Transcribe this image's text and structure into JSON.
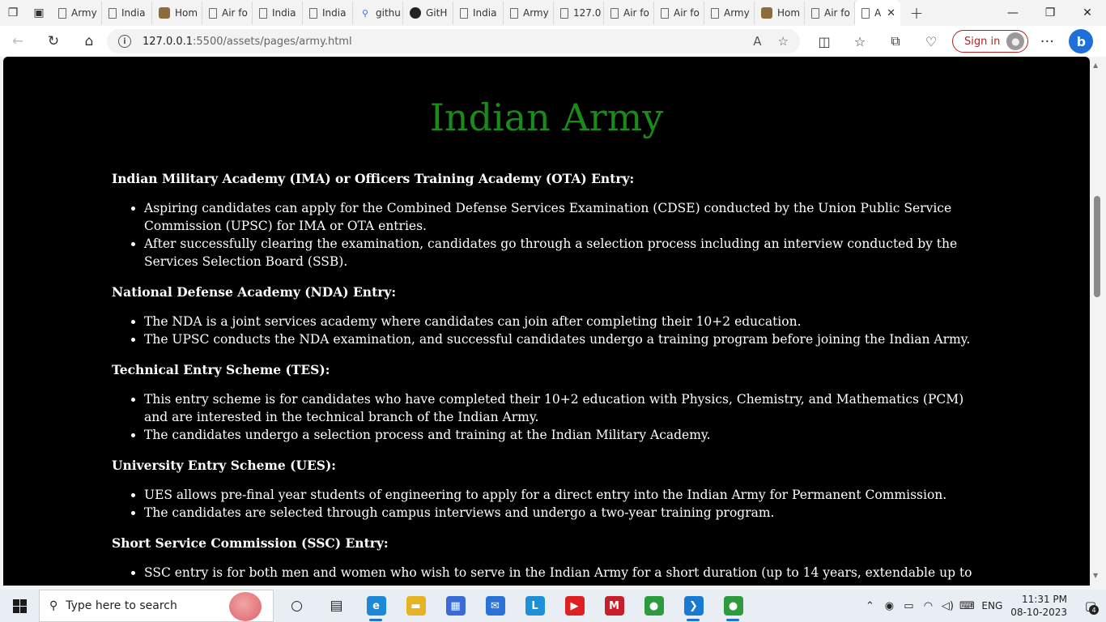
{
  "browser": {
    "tabs": [
      {
        "label": "Army",
        "icon": "page-icon"
      },
      {
        "label": "India",
        "icon": "page-icon"
      },
      {
        "label": "Hom",
        "icon": "emblem-icon"
      },
      {
        "label": "Air fo",
        "icon": "page-icon"
      },
      {
        "label": "India",
        "icon": "page-icon"
      },
      {
        "label": "India",
        "icon": "page-icon"
      },
      {
        "label": "githu",
        "icon": "search-icon"
      },
      {
        "label": "GitH",
        "icon": "github-icon"
      },
      {
        "label": "India",
        "icon": "page-icon"
      },
      {
        "label": "Army",
        "icon": "page-icon"
      },
      {
        "label": "127.0",
        "icon": "page-icon"
      },
      {
        "label": "Air fo",
        "icon": "page-icon"
      },
      {
        "label": "Air fo",
        "icon": "page-icon"
      },
      {
        "label": "Army",
        "icon": "page-icon"
      },
      {
        "label": "Hom",
        "icon": "emblem-icon"
      },
      {
        "label": "Air fo",
        "icon": "page-icon"
      }
    ],
    "active_tab": {
      "label": "A",
      "close": "✕"
    },
    "new_tab": "+",
    "url_host": "127.0.0.1",
    "url_rest": ":5500/assets/pages/army.html",
    "signin_label": "Sign in",
    "more": "···"
  },
  "page": {
    "title": "Indian Army",
    "title_color": "#1a8a1a",
    "sections": [
      {
        "heading": "Indian Military Academy (IMA) or Officers Training Academy (OTA) Entry:",
        "items": [
          "Aspiring candidates can apply for the Combined Defense Services Examination (CDSE) conducted by the Union Public Service Commission (UPSC) for IMA or OTA entries.",
          "After successfully clearing the examination, candidates go through a selection process including an interview conducted by the Services Selection Board (SSB)."
        ]
      },
      {
        "heading": "National Defense Academy (NDA) Entry:",
        "items": [
          "The NDA is a joint services academy where candidates can join after completing their 10+2 education.",
          "The UPSC conducts the NDA examination, and successful candidates undergo a training program before joining the Indian Army."
        ]
      },
      {
        "heading": "Technical Entry Scheme (TES):",
        "items": [
          "This entry scheme is for candidates who have completed their 10+2 education with Physics, Chemistry, and Mathematics (PCM) and are interested in the technical branch of the Indian Army.",
          "The candidates undergo a selection process and training at the Indian Military Academy."
        ]
      },
      {
        "heading": "University Entry Scheme (UES):",
        "items": [
          "UES allows pre-final year students of engineering to apply for a direct entry into the Indian Army for Permanent Commission.",
          "The candidates are selected through campus interviews and undergo a two-year training program."
        ]
      },
      {
        "heading": "Short Service Commission (SSC) Entry:",
        "items": [
          "SSC entry is for both men and women who wish to serve in the Indian Army for a short duration (up to 14 years, extendable up to"
        ]
      }
    ]
  },
  "taskbar": {
    "search_placeholder": "Type here to search",
    "apps": [
      {
        "name": "task-view-icon",
        "glyph": "○",
        "color": "transparent",
        "running": false
      },
      {
        "name": "widgets-icon",
        "glyph": "▤",
        "color": "transparent",
        "running": false
      },
      {
        "name": "edge-icon",
        "glyph": "e",
        "color": "#1e88d6",
        "running": true
      },
      {
        "name": "file-explorer-icon",
        "glyph": "▬",
        "color": "#e6b422",
        "running": false
      },
      {
        "name": "store-icon",
        "glyph": "▦",
        "color": "#3a6ad6",
        "running": false
      },
      {
        "name": "mail-icon",
        "glyph": "✉",
        "color": "#2a72d6",
        "running": false
      },
      {
        "name": "l-app-icon",
        "glyph": "L",
        "color": "#1e90d6",
        "running": false
      },
      {
        "name": "youtube-icon",
        "glyph": "▶",
        "color": "#e02020",
        "running": false
      },
      {
        "name": "mcafee-icon",
        "glyph": "M",
        "color": "#c8202a",
        "running": false
      },
      {
        "name": "chrome-icon",
        "glyph": "●",
        "color": "#2e9a3e",
        "running": false
      },
      {
        "name": "vscode-icon",
        "glyph": "❯",
        "color": "#1a7ad2",
        "running": true
      },
      {
        "name": "chrome-profile-icon",
        "glyph": "●",
        "color": "#2e9a3e",
        "running": true
      }
    ],
    "language": "ENG",
    "time": "11:31 PM",
    "date": "08-10-2023",
    "notification_count": "4"
  }
}
